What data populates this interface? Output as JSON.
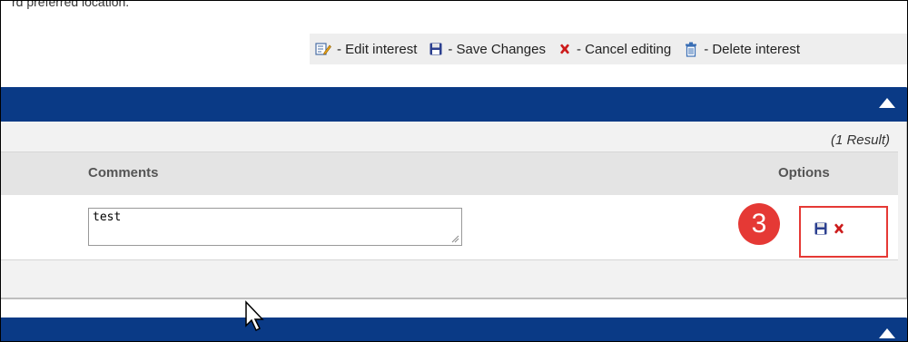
{
  "top_text": "rd preferred location.",
  "legend": {
    "edit": "- Edit interest",
    "save": "- Save Changes",
    "cancel": "- Cancel editing",
    "delete": "- Delete interest"
  },
  "result_count": "(1 Result)",
  "table": {
    "headers": {
      "comments": "Comments",
      "options": "Options"
    },
    "rows": [
      {
        "comment_value": "test"
      }
    ]
  },
  "step_badge": "3",
  "icons": {
    "edit": "edit-pencil-icon",
    "save": "floppy-disk-icon",
    "cancel": "red-x-icon",
    "delete": "trash-can-icon",
    "collapse": "caret-up-icon"
  },
  "colors": {
    "header_blue": "#0a3a86",
    "highlight_red": "#e53935"
  }
}
